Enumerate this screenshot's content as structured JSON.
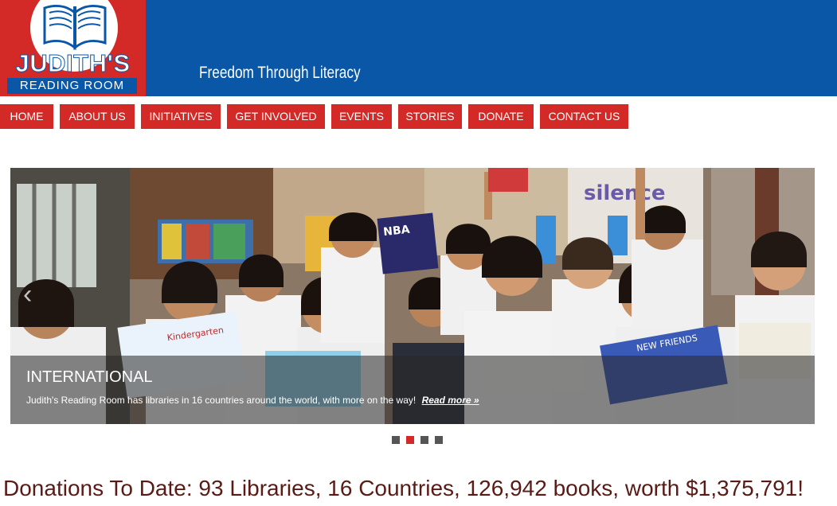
{
  "site": {
    "logo_name": "JUDITH'S",
    "logo_sub": "READING ROOM",
    "tagline": "Freedom Through Literacy"
  },
  "nav": [
    {
      "label": "HOME"
    },
    {
      "label": "ABOUT US"
    },
    {
      "label": "INITIATIVES"
    },
    {
      "label": "GET INVOLVED"
    },
    {
      "label": "EVENTS"
    },
    {
      "label": "STORIES"
    },
    {
      "label": "DONATE"
    },
    {
      "label": "CONTACT US"
    }
  ],
  "slide": {
    "title": "INTERNATIONAL",
    "text": "Judith's Reading Room has libraries in 16 countries around the world, with more on the way!",
    "link": "Read more »",
    "prev_glyph": "‹",
    "book_cover_text": "NBA",
    "book_kindergarten": "Kindergarten",
    "book_new_friends": "NEW FRIENDS",
    "wall_word": "silence"
  },
  "slider_dots": {
    "count": 4,
    "active_index": 1
  },
  "donations": "Donations To Date: 93 Libraries, 16 Countries, 126,942 books, worth $1,375,791!",
  "colors": {
    "brand_red": "#d42a27",
    "brand_blue": "#0a57a8",
    "donation_text": "#5a1a16"
  }
}
